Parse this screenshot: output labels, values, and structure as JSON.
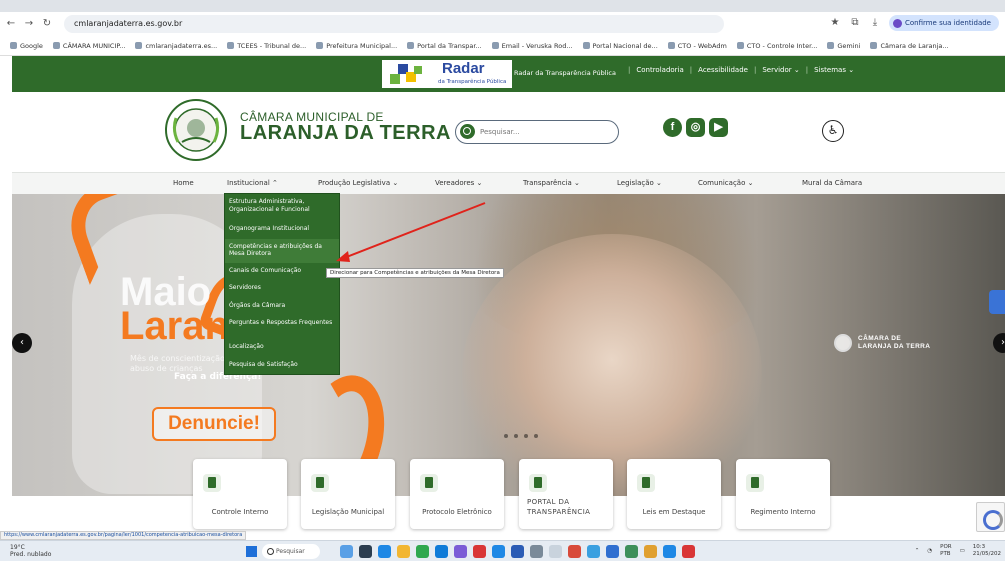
{
  "browser": {
    "url": "cmlaranjadaterra.es.gov.br",
    "profile_label": "Confirme sua identidade",
    "bookmarks": [
      "Google",
      "CÂMARA MUNICIP...",
      "cmlaranjadaterra.es...",
      "TCEES - Tribunal de...",
      "Prefeitura Municipal...",
      "Portal da Transpar...",
      "Email - Veruska Rod...",
      "Portal Nacional de...",
      "CTO - WebAdm",
      "CTO - Controle Inter...",
      "Gemini",
      "Câmara de Laranja..."
    ]
  },
  "topbar": {
    "radar_title": "Radar",
    "radar_subtitle": "da Transparência Pública",
    "radar_caption": "Radar da Transparência Pública",
    "links": [
      "Controladoria",
      "Acessibilidade",
      "Servidor ⌄",
      "Sistemas ⌄"
    ]
  },
  "header": {
    "brand_line1": "CÂMARA MUNICIPAL DE",
    "brand_line2": "LARANJA DA TERRA",
    "search_placeholder": "Pesquisar...",
    "social": [
      "f",
      "◎",
      "▶"
    ]
  },
  "nav": {
    "items": [
      "Home",
      "Institucional ⌃",
      "Produção Legislativa ⌄",
      "Vereadores ⌄",
      "Transparência ⌄",
      "Legislação ⌄",
      "Comunicação ⌄",
      "Mural da Câmara"
    ]
  },
  "dropdown": {
    "items": [
      "Estrutura Administrativa, Organizacional e Funcional",
      "Organograma Institucional",
      "Competências e atribuições da Mesa Diretora",
      "Canais de Comunicação",
      "Servidores",
      "Órgãos da Câmara",
      "Perguntas e Respostas Frequentes",
      "Localização",
      "Pesquisa de Satisfação"
    ],
    "tooltip": "Direcionar para Competências e atribuições da Mesa Diretora"
  },
  "hero": {
    "line1": "Maio",
    "line2": "Laranja",
    "sub1": "Mês de conscientização",
    "sub2": "abuso de crianças",
    "call": "Faça a diferença!",
    "button": "Denuncie!",
    "seal_line1": "CÂMARA DE",
    "seal_line2": "LARANJA DA TERRA"
  },
  "cards": [
    "Controle Interno",
    "Legislação Municipal",
    "Protocolo Eletrônico",
    "PORTAL DA TRANSPARÊNCIA",
    "Leis em Destaque",
    "Regimento Interno"
  ],
  "status_url": "https://www.cmlaranjadaterra.es.gov.br/pagina/ler/1001/competencia-atribuicao-mesa-diretora",
  "taskbar": {
    "weather_temp": "19°C",
    "weather_desc": "Pred. nublado",
    "search": "Pesquisar",
    "lang1": "POR",
    "lang2": "PTB",
    "time": "10:3",
    "date": "21/05/202"
  },
  "colors": {
    "brand_green": "#2f6b2a",
    "accent_orange": "#f47a20"
  }
}
